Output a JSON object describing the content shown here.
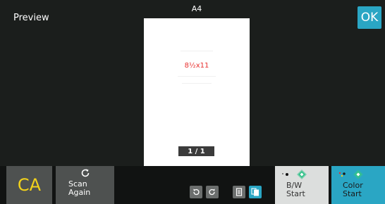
{
  "header": {
    "title": "Preview",
    "paper_size": "A4",
    "ok_label": "OK"
  },
  "preview": {
    "page_size_text": "8½x11",
    "page_counter": "1 / 1"
  },
  "footer": {
    "ca_label": "CA",
    "scan_again_line1": "Scan",
    "scan_again_line2": "Again",
    "bw_start_line1": "B/W",
    "bw_start_line2": "Start",
    "color_start_line1": "Color",
    "color_start_line2": "Start",
    "tools": [
      "rotate-left-icon",
      "rotate-right-icon",
      "single-page-view-icon",
      "multi-page-view-icon"
    ]
  },
  "colors": {
    "background": "#1b1e1c",
    "ok_button": "#2aa6c4",
    "ca_text": "#f2d21b",
    "page_size_text": "#e8302f",
    "bw_button": "#dcdedd",
    "color_button": "#2aa6c4",
    "start_diamond": "#34c28a"
  }
}
